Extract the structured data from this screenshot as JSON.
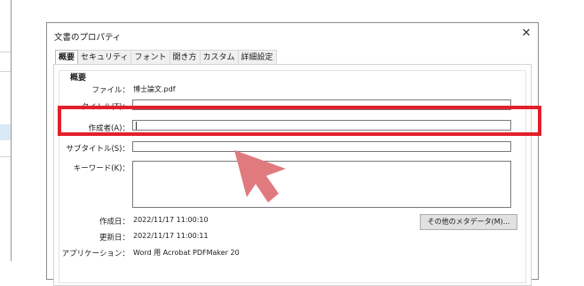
{
  "window": {
    "title": "文書のプロパティ",
    "close_symbol": "✕"
  },
  "tabs": [
    {
      "label": "概要",
      "active": true
    },
    {
      "label": "セキュリティ",
      "active": false
    },
    {
      "label": "フォント",
      "active": false
    },
    {
      "label": "開き方",
      "active": false
    },
    {
      "label": "カスタム",
      "active": false
    },
    {
      "label": "詳細設定",
      "active": false
    }
  ],
  "summary": {
    "group_label": "概要",
    "file_label": "ファイル：",
    "file_value": "博士論文.pdf",
    "title_label": "タイトル(T)：",
    "title_value": "",
    "author_label": "作成者(A)：",
    "author_value": "",
    "subject_label": "サブタイトル(S)：",
    "subject_value": "",
    "keywords_label": "キーワード(K)：",
    "keywords_value": "",
    "created_label": "作成日：",
    "created_value": "2022/11/17 11:00:10",
    "modified_label": "更新日：",
    "modified_value": "2022/11/17 11:00:11",
    "application_label": "アプリケーション：",
    "application_value": "Word 用 Acrobat PDFMaker 20",
    "more_metadata_button": "その他のメタデータ(M)..."
  },
  "annotation": {
    "highlight_color": "#e2202a",
    "arrow_color": "#e07a7f"
  }
}
